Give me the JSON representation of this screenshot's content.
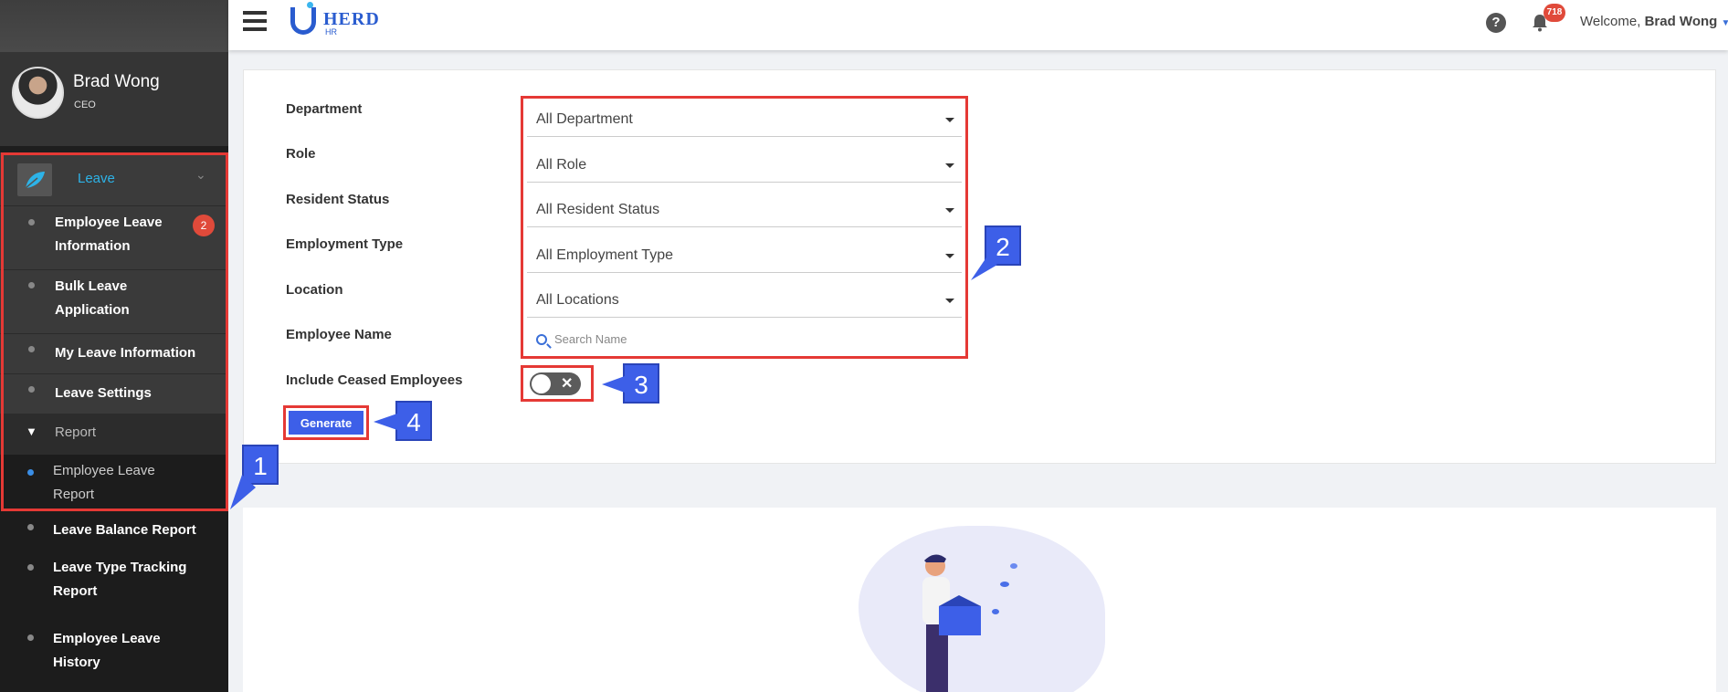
{
  "user": {
    "name": "Brad Wong",
    "role": "CEO"
  },
  "sidebar": {
    "leave_label": "Leave",
    "items": [
      {
        "label": "Employee Leave\nInformation",
        "badge": "2"
      },
      {
        "label": "Bulk Leave\nApplication"
      },
      {
        "label": "My Leave Information"
      },
      {
        "label": "Leave Settings"
      }
    ],
    "report_label": "Report",
    "report_items": [
      {
        "label": "Employee Leave\nReport"
      },
      {
        "label": "Leave Balance Report"
      },
      {
        "label": "Leave Type Tracking\nReport"
      },
      {
        "label": "Employee Leave\nHistory"
      }
    ]
  },
  "header": {
    "logo_text": "HERD",
    "logo_sub": "HR",
    "notification_count": "718",
    "welcome": "Welcome,",
    "user_name": "Brad Wong"
  },
  "form": {
    "labels": {
      "department": "Department",
      "role": "Role",
      "resident_status": "Resident Status",
      "employment_type": "Employment Type",
      "location": "Location",
      "employee_name": "Employee Name",
      "include_ceased": "Include Ceased Employees"
    },
    "values": {
      "department": "All Department",
      "role": "All Role",
      "resident_status": "All Resident Status",
      "employment_type": "All Employment Type",
      "location": "All Locations"
    },
    "search_placeholder": "Search Name",
    "generate_label": "Generate"
  },
  "callouts": [
    "1",
    "2",
    "3",
    "4"
  ]
}
